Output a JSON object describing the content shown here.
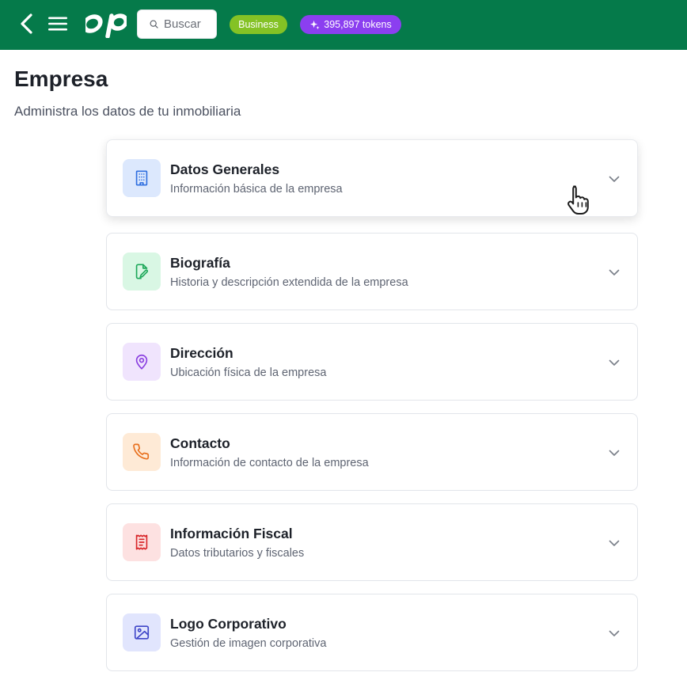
{
  "header": {
    "search_placeholder": "Buscar",
    "plan_badge": "Business",
    "tokens_badge": "395,897 tokens"
  },
  "page": {
    "title": "Empresa",
    "subtitle": "Administra los datos de tu inmobiliaria"
  },
  "sections": [
    {
      "title": "Datos Generales",
      "description": "Información básica de la empresa",
      "icon": "building-icon",
      "color": "#2f6fe0",
      "bg": "#dce8fd"
    },
    {
      "title": "Biografía",
      "description": "Historia y descripción extendida de la empresa",
      "icon": "file-edit-icon",
      "color": "#1ea85a",
      "bg": "#d9f7e4"
    },
    {
      "title": "Dirección",
      "description": "Ubicación física de la empresa",
      "icon": "map-pin-icon",
      "color": "#8a3fe0",
      "bg": "#f0e4fd"
    },
    {
      "title": "Contacto",
      "description": "Información de contacto de la empresa",
      "icon": "phone-icon",
      "color": "#e8701e",
      "bg": "#feead6"
    },
    {
      "title": "Información Fiscal",
      "description": "Datos tributarios y fiscales",
      "icon": "receipt-icon",
      "color": "#d8262a",
      "bg": "#fde1e1"
    },
    {
      "title": "Logo Corporativo",
      "description": "Gestión de imagen corporativa",
      "icon": "image-icon",
      "color": "#3f46c8",
      "bg": "#e1e5fd"
    }
  ],
  "colors": {
    "header_bg": "#057a4a",
    "business_badge": "#84c225",
    "tokens_badge": "#8b3ff0"
  }
}
